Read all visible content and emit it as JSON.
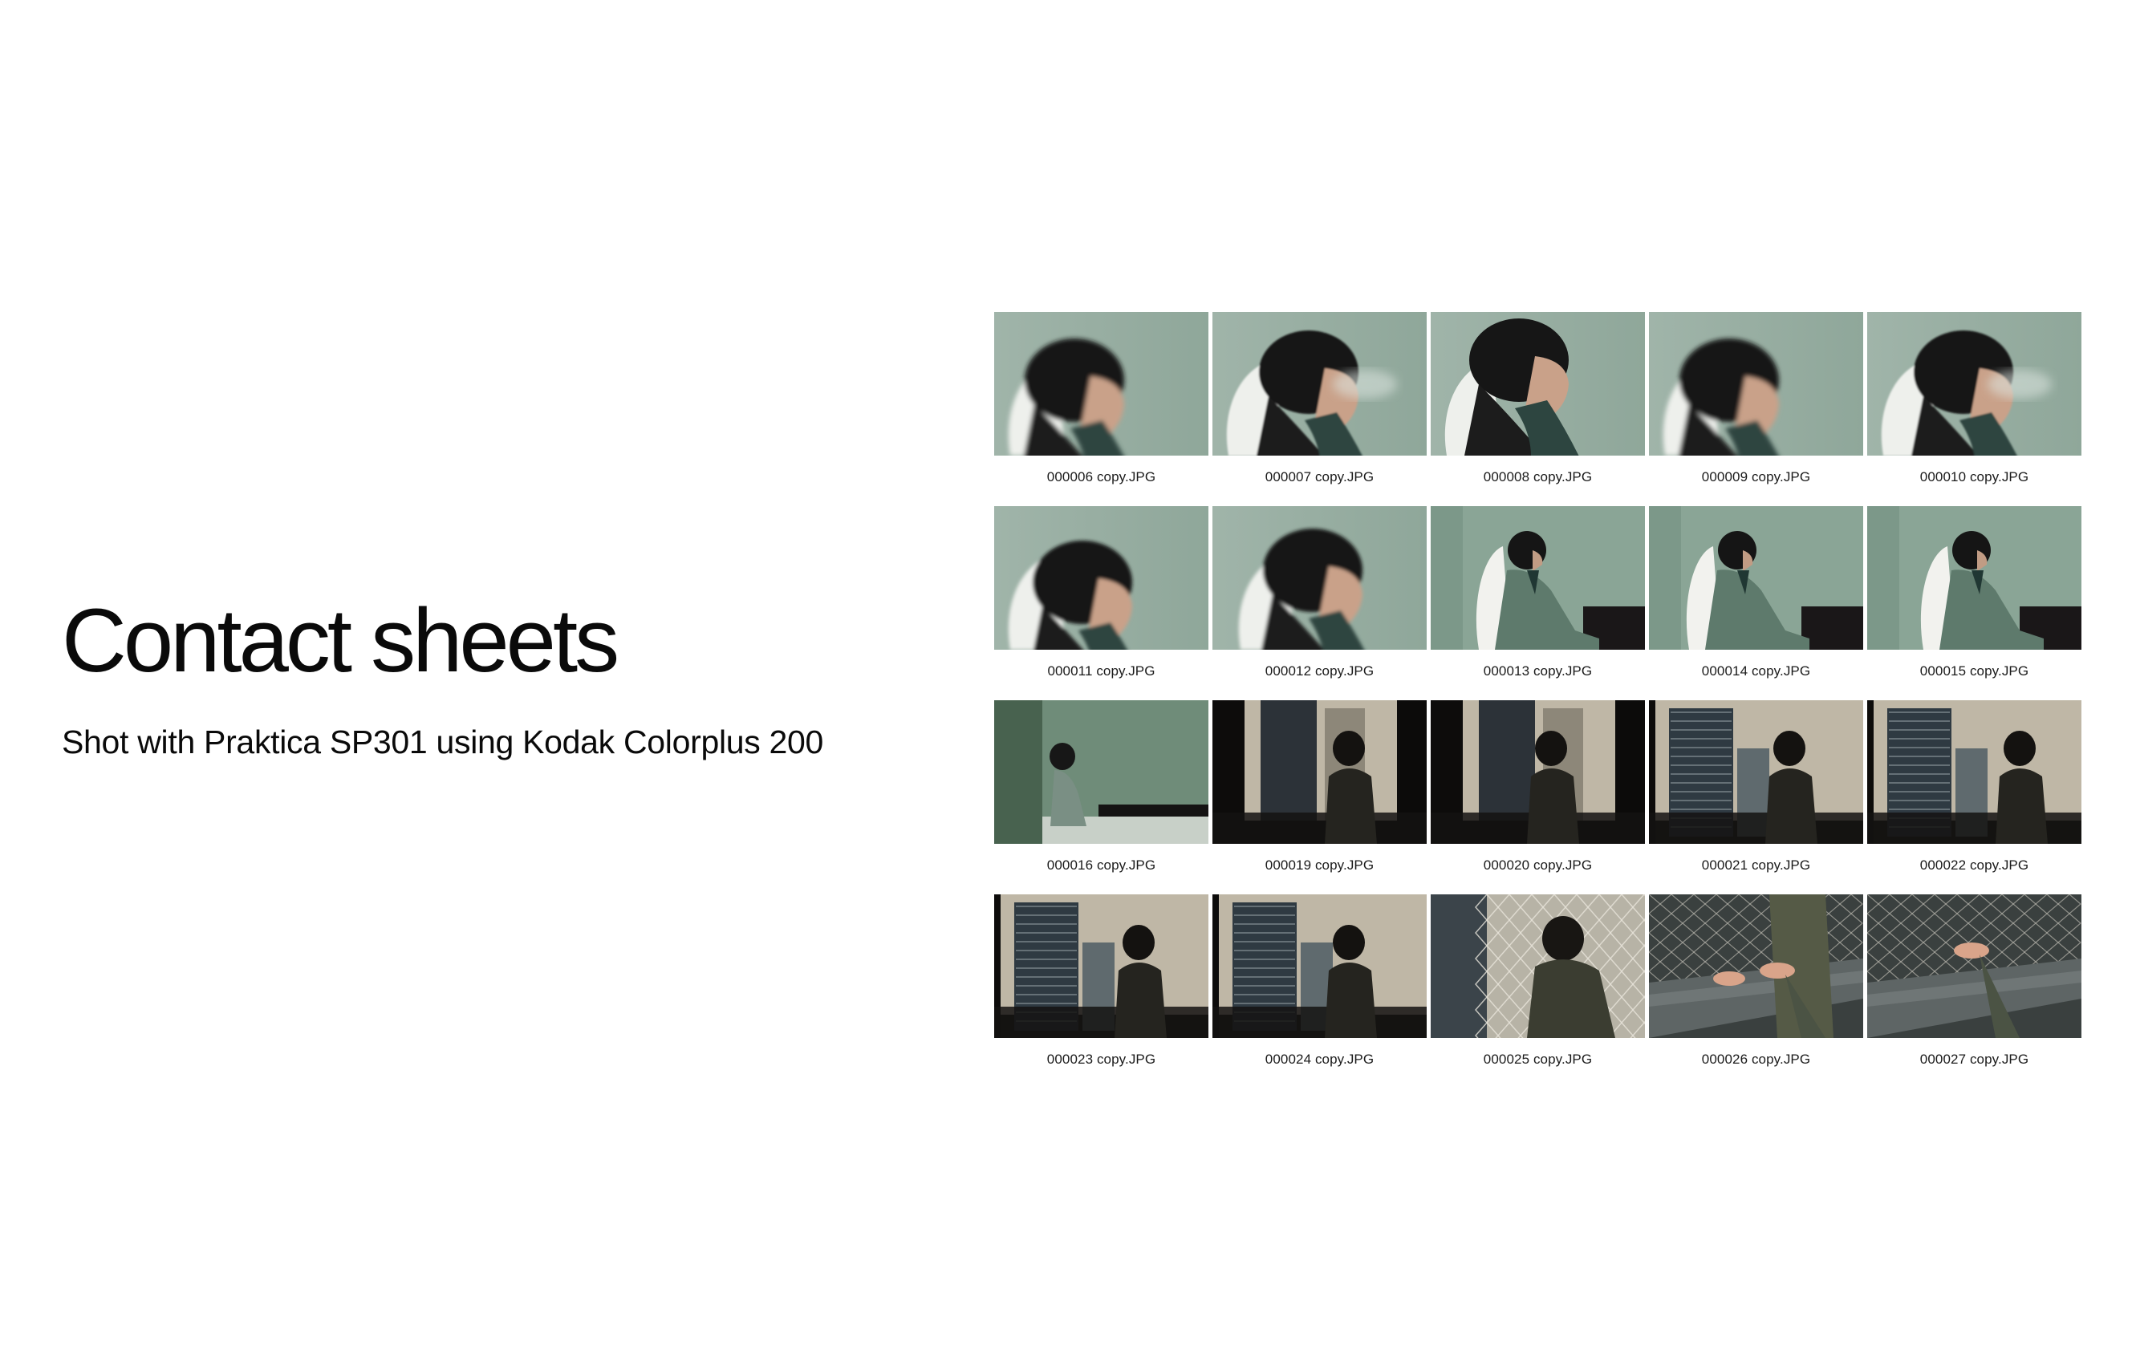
{
  "title": "Contact sheets",
  "subtitle": "Shot with Praktica SP301 using Kodak Colorplus 200",
  "frames": [
    {
      "filename": "000006 copy.JPG",
      "scene": "wall-profile-blur"
    },
    {
      "filename": "000007 copy.JPG",
      "scene": "wall-profile-smoke"
    },
    {
      "filename": "000008 copy.JPG",
      "scene": "wall-profile-close"
    },
    {
      "filename": "000009 copy.JPG",
      "scene": "wall-profile-blur"
    },
    {
      "filename": "000010 copy.JPG",
      "scene": "wall-profile-smoke"
    },
    {
      "filename": "000011 copy.JPG",
      "scene": "wall-profile-low"
    },
    {
      "filename": "000012 copy.JPG",
      "scene": "wall-profile-pillow"
    },
    {
      "filename": "000013 copy.JPG",
      "scene": "bed-sitting"
    },
    {
      "filename": "000014 copy.JPG",
      "scene": "bed-sitting-wide"
    },
    {
      "filename": "000015 copy.JPG",
      "scene": "bed-lying"
    },
    {
      "filename": "000016 copy.JPG",
      "scene": "bed-far"
    },
    {
      "filename": "000019 copy.JPG",
      "scene": "window-dark"
    },
    {
      "filename": "000020 copy.JPG",
      "scene": "window-dark-2"
    },
    {
      "filename": "000021 copy.JPG",
      "scene": "window-tower"
    },
    {
      "filename": "000022 copy.JPG",
      "scene": "window-tower-2"
    },
    {
      "filename": "000023 copy.JPG",
      "scene": "window-tower-3"
    },
    {
      "filename": "000024 copy.JPG",
      "scene": "window-close"
    },
    {
      "filename": "000025 copy.JPG",
      "scene": "window-net"
    },
    {
      "filename": "000026 copy.JPG",
      "scene": "ledge-hands"
    },
    {
      "filename": "000027 copy.JPG",
      "scene": "ledge-hand"
    }
  ]
}
